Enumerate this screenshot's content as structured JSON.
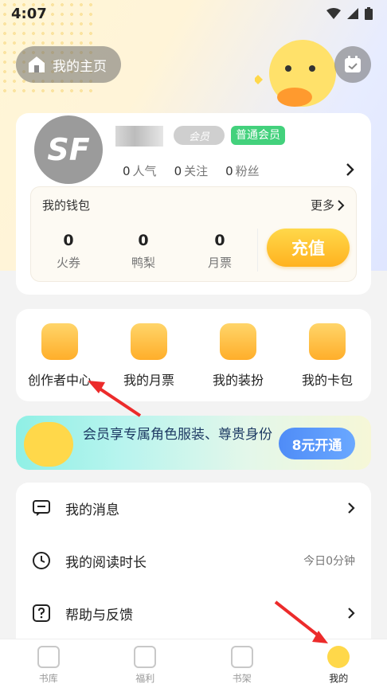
{
  "status": {
    "time": "4:07"
  },
  "header": {
    "homepage_label": "我的主页"
  },
  "profile": {
    "vip_badge": "会员",
    "member_tag": "普通会员",
    "avatar_text": "SF",
    "stats": [
      {
        "num": "0",
        "label": "人气"
      },
      {
        "num": "0",
        "label": "关注"
      },
      {
        "num": "0",
        "label": "粉丝"
      }
    ]
  },
  "wallet": {
    "title": "我的钱包",
    "more": "更多",
    "items": [
      {
        "value": "0",
        "label": "火券"
      },
      {
        "value": "0",
        "label": "鸭梨"
      },
      {
        "value": "0",
        "label": "月票"
      }
    ],
    "recharge": "充值"
  },
  "features": [
    {
      "label": "创作者中心",
      "icon": "creator-icon"
    },
    {
      "label": "我的月票",
      "icon": "ticket-icon"
    },
    {
      "label": "我的装扮",
      "icon": "star-icon"
    },
    {
      "label": "我的卡包",
      "icon": "card-icon"
    }
  ],
  "banner": {
    "text": "会员享专属角色服装、尊贵身份",
    "button": "8元开通"
  },
  "menu": [
    {
      "label": "我的消息",
      "right": "",
      "icon": "message-icon"
    },
    {
      "label": "我的阅读时长",
      "right": "今日0分钟",
      "icon": "clock-icon"
    },
    {
      "label": "帮助与反馈",
      "right": "",
      "icon": "help-icon"
    }
  ],
  "tabs": [
    {
      "label": "书库",
      "icon": "library-icon"
    },
    {
      "label": "福利",
      "icon": "gift-icon"
    },
    {
      "label": "书架",
      "icon": "bookshelf-icon"
    },
    {
      "label": "我的",
      "icon": "profile-icon",
      "active": true
    }
  ],
  "colors": {
    "accent": "#ffb21f",
    "member_green": "#43d17c",
    "arrow_red": "#ec2b2b",
    "vip_blue": "#4f8cf7"
  }
}
